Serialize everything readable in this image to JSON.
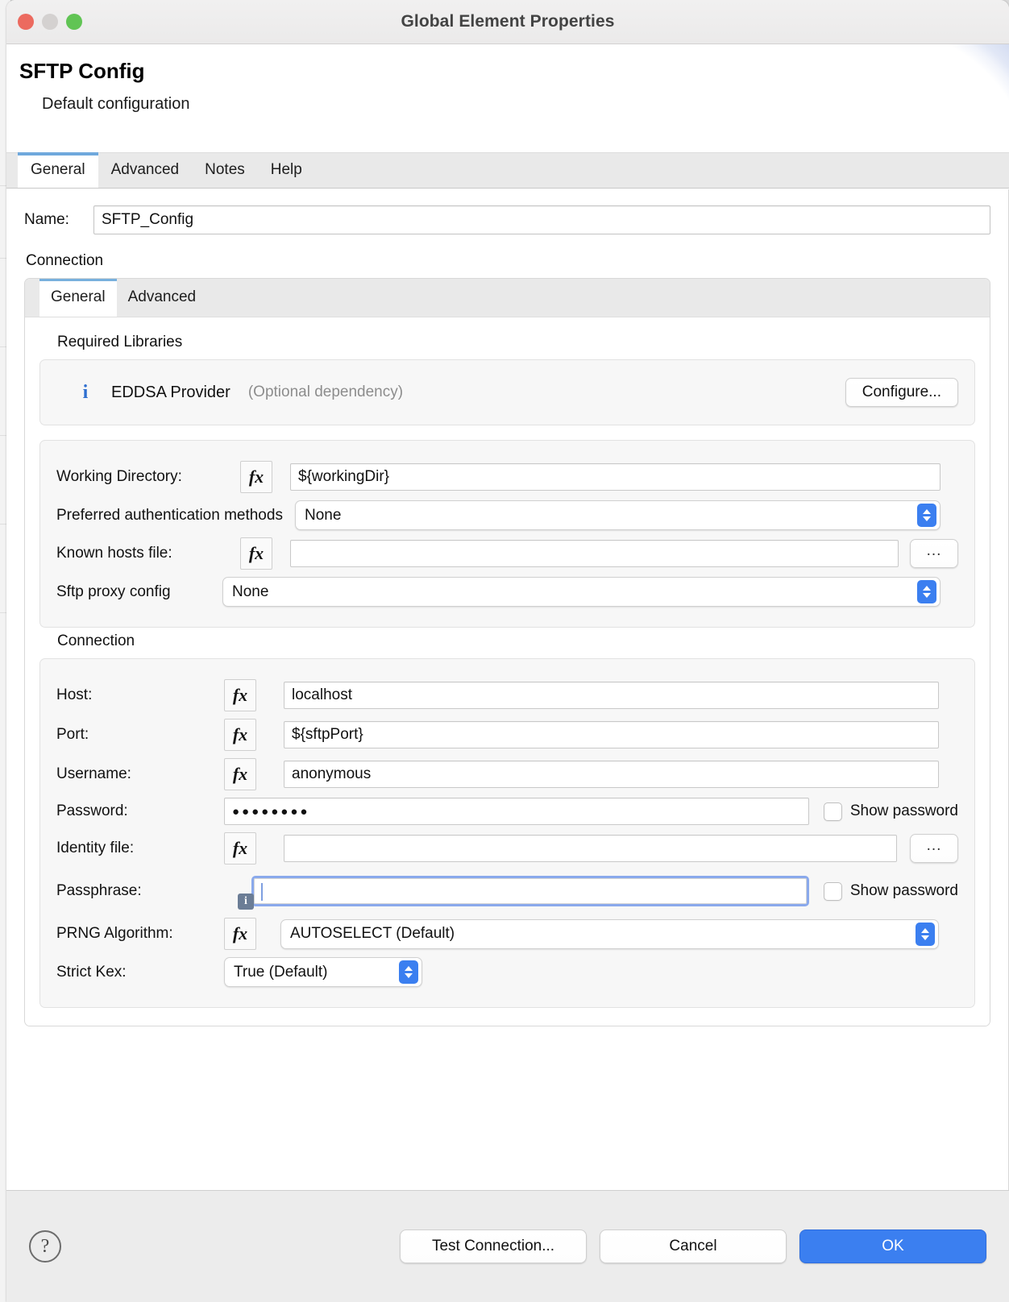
{
  "window": {
    "title": "Global Element Properties",
    "traffic_lights": [
      "close-button",
      "minimize-button",
      "zoom-button"
    ]
  },
  "header": {
    "title": "SFTP Config",
    "subtitle": "Default configuration"
  },
  "outer_tabs": [
    {
      "label": "General",
      "active": true
    },
    {
      "label": "Advanced",
      "active": false
    },
    {
      "label": "Notes",
      "active": false
    },
    {
      "label": "Help",
      "active": false
    }
  ],
  "name_field": {
    "label": "Name:",
    "value": "SFTP_Config",
    "placeholder": ""
  },
  "connection_section_label": "Connection",
  "inner_tabs": [
    {
      "label": "General",
      "active": true
    },
    {
      "label": "Advanced",
      "active": false
    }
  ],
  "required_libraries": {
    "title": "Required Libraries",
    "item": {
      "icon": "info-icon",
      "name": "EDDSA Provider",
      "note": "(Optional dependency)",
      "button": "Configure..."
    }
  },
  "general_group": {
    "working_directory": {
      "label": "Working Directory:",
      "fx": "fx",
      "value": "${workingDir}"
    },
    "preferred_auth": {
      "label": "Preferred authentication methods",
      "value": "None"
    },
    "known_hosts": {
      "label": "Known hosts file:",
      "fx": "fx",
      "value": "",
      "browse": "..."
    },
    "sftp_proxy": {
      "label": "Sftp proxy config",
      "value": "None"
    }
  },
  "connection_group": {
    "title": "Connection",
    "host": {
      "label": "Host:",
      "fx": "fx",
      "value": "localhost"
    },
    "port": {
      "label": "Port:",
      "fx": "fx",
      "value": "${sftpPort}"
    },
    "username": {
      "label": "Username:",
      "fx": "fx",
      "value": "anonymous"
    },
    "password": {
      "label": "Password:",
      "masked_value": "●●●●●●●●",
      "show_label": "Show password",
      "checked": false
    },
    "identity_file": {
      "label": "Identity file:",
      "fx": "fx",
      "value": "",
      "browse": "..."
    },
    "passphrase": {
      "label": "Passphrase:",
      "value": "",
      "badge": "i",
      "show_label": "Show password",
      "checked": false,
      "focused": true
    },
    "prng": {
      "label": "PRNG Algorithm:",
      "fx": "fx",
      "value": "AUTOSELECT (Default)"
    },
    "strict_kex": {
      "label": "Strict Kex:",
      "value": "True (Default)"
    }
  },
  "footer": {
    "help": "?",
    "test_connection": "Test Connection...",
    "cancel": "Cancel",
    "ok": "OK"
  },
  "colors": {
    "accent_blue": "#3b7ff0",
    "tab_underline": "#6fa8dc",
    "focus_ring": "#8aa9ec",
    "info_blue": "#2f6fd0"
  }
}
